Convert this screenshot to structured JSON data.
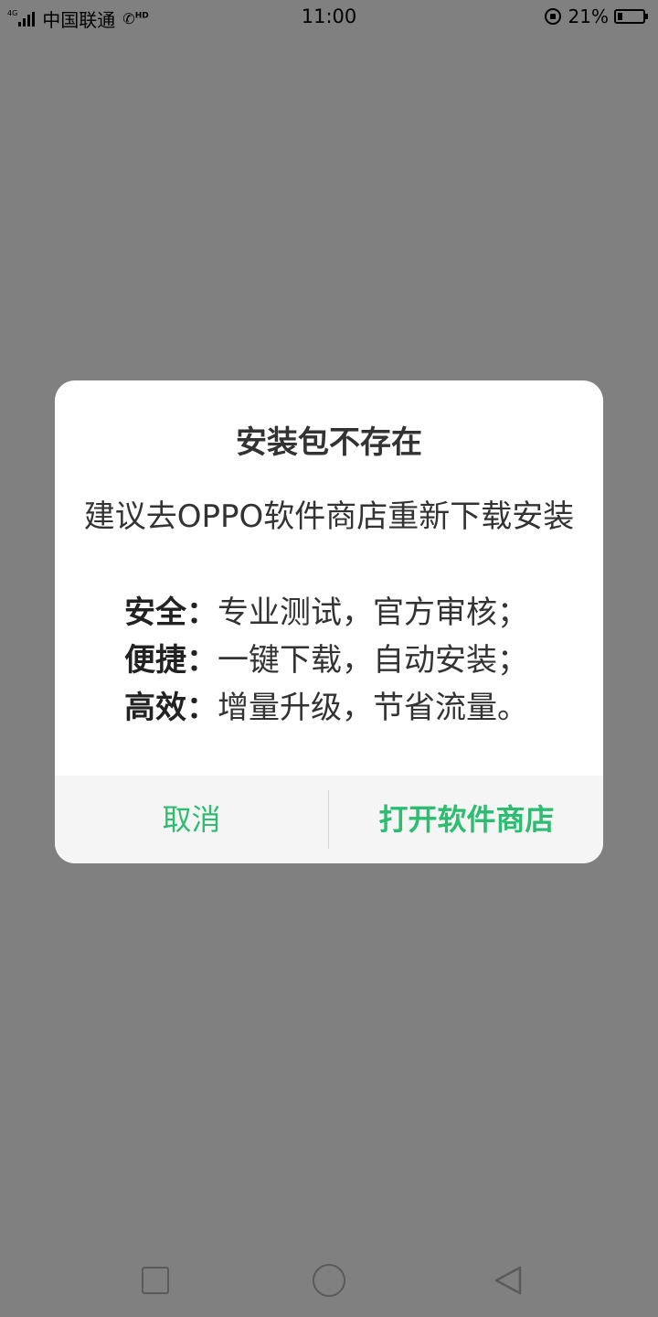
{
  "status_bar": {
    "network_type": "4G",
    "carrier": "中国联通",
    "call_badge": "HD",
    "time": "11:00",
    "battery_percent": "21%",
    "battery_level": 0.21,
    "icons": [
      "signal-icon",
      "hd-call-icon",
      "rotation-lock-icon",
      "battery-icon"
    ]
  },
  "dialog": {
    "title": "安装包不存在",
    "message": "建议去OPPO软件商店重新下载安装",
    "features": [
      {
        "label": "安全：",
        "text": "专业测试，官方审核；"
      },
      {
        "label": "便捷：",
        "text": "一键下载，自动安装；"
      },
      {
        "label": "高效：",
        "text": "增量升级，节省流量。"
      }
    ],
    "cancel_label": "取消",
    "confirm_label": "打开软件商店"
  },
  "colors": {
    "backdrop": "#808080",
    "dialog_bg": "#ffffff",
    "button_bar_bg": "#f5f5f5",
    "accent_green": "#2cbd70"
  },
  "nav_bar": {
    "icons": [
      "recents-icon",
      "home-icon",
      "back-icon"
    ]
  }
}
